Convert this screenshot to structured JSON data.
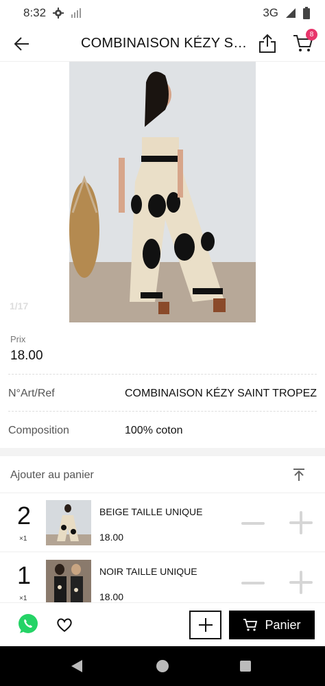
{
  "status": {
    "time": "8:32",
    "network": "3G",
    "icons": [
      "gear-icon",
      "signal-off-icon",
      "signal-icon",
      "battery-icon"
    ]
  },
  "header": {
    "title": "COMBINAISON KÉZY SA...",
    "cart_count": "8",
    "icons": [
      "back-arrow-icon",
      "share-icon",
      "cart-icon"
    ]
  },
  "gallery": {
    "counter": "1/17"
  },
  "product": {
    "price_label": "Prix",
    "price": "18.00",
    "ref_label": "N°Art/Ref",
    "ref_value": "COMBINAISON KÉZY SAINT TROPEZ",
    "composition_label": "Composition",
    "composition_value": "100% coton"
  },
  "add_to_cart": {
    "label": "Ajouter au panier",
    "variants": [
      {
        "qty": "2",
        "mult": "×1",
        "name": "BEIGE TAILLE UNIQUE",
        "price": "18.00"
      },
      {
        "qty": "1",
        "mult": "×1",
        "name": "NOIR TAILLE UNIQUE",
        "price": "18.00"
      }
    ]
  },
  "bottom_bar": {
    "cart_button": "Panier",
    "icons": [
      "whatsapp-icon",
      "heart-icon",
      "add-icon",
      "cart-icon"
    ]
  },
  "colors": {
    "accent": "#e8356b",
    "whatsapp": "#25d366",
    "primary_button": "#000000"
  }
}
